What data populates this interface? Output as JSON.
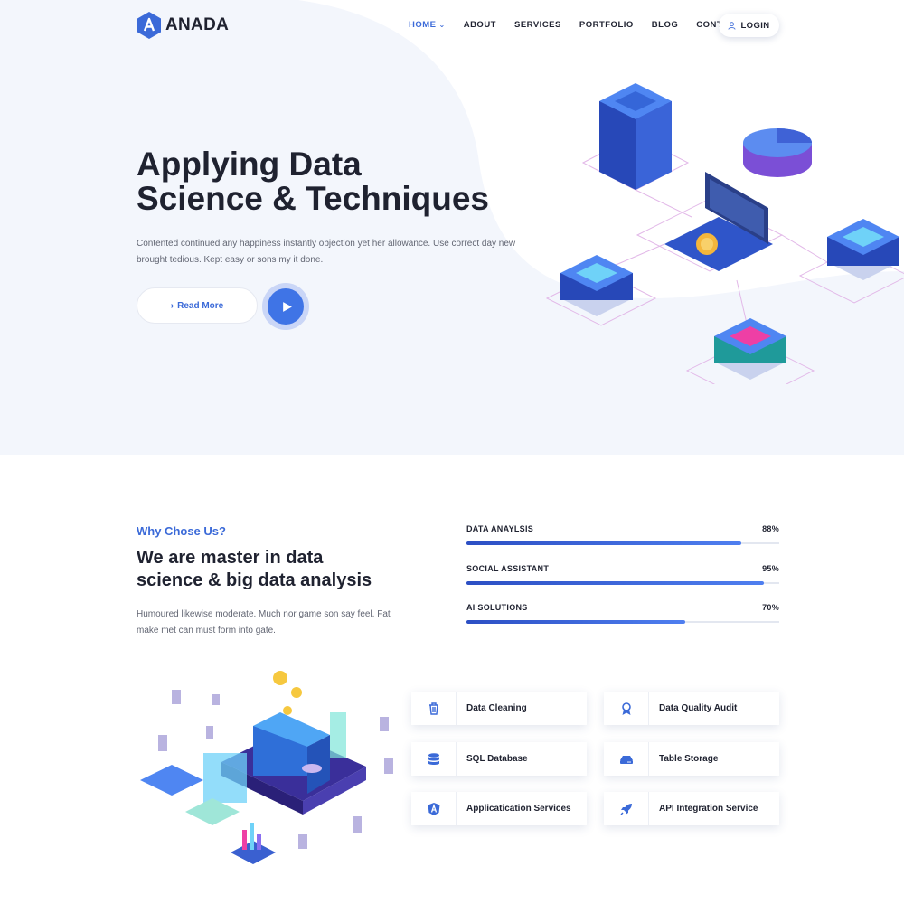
{
  "brand": {
    "name": "ANADA",
    "accent": "#3b6ad8"
  },
  "nav": {
    "items": [
      {
        "label": "HOME",
        "active": true,
        "has_dropdown": true
      },
      {
        "label": "ABOUT",
        "active": false
      },
      {
        "label": "SERVICES",
        "active": false
      },
      {
        "label": "PORTFOLIO",
        "active": false
      },
      {
        "label": "BLOG",
        "active": false
      },
      {
        "label": "CONTACT",
        "active": false
      }
    ],
    "login_label": "LOGIN"
  },
  "hero": {
    "title_line1": "Applying Data",
    "title_line2": "Science & Techniques",
    "text": "Contented continued any happiness instantly objection yet her allowance. Use correct day new brought tedious. Kept easy or sons my it done.",
    "read_more_label": "Read More"
  },
  "why": {
    "kicker": "Why Chose Us?",
    "title_line1": "We are master in data",
    "title_line2": "science & big data analysis",
    "text": "Humoured likewise moderate. Much nor game son say feel. Fat make met can must form into gate."
  },
  "skills": [
    {
      "label": "DATA ANAYLSIS",
      "percent_label": "88%",
      "value": 0.88
    },
    {
      "label": "SOCIAL ASSISTANT",
      "percent_label": "95%",
      "value": 0.95
    },
    {
      "label": "AI SOLUTIONS",
      "percent_label": "70%",
      "value": 0.7
    }
  ],
  "services": [
    {
      "label": "Data Cleaning",
      "icon": "trash-icon"
    },
    {
      "label": "Data Quality Audit",
      "icon": "award-icon"
    },
    {
      "label": "SQL Database",
      "icon": "database-icon"
    },
    {
      "label": "Table Storage",
      "icon": "hdd-icon"
    },
    {
      "label": "Applicatication Services",
      "icon": "angular-icon"
    },
    {
      "label": "API Integration Service",
      "icon": "rocket-icon"
    }
  ]
}
